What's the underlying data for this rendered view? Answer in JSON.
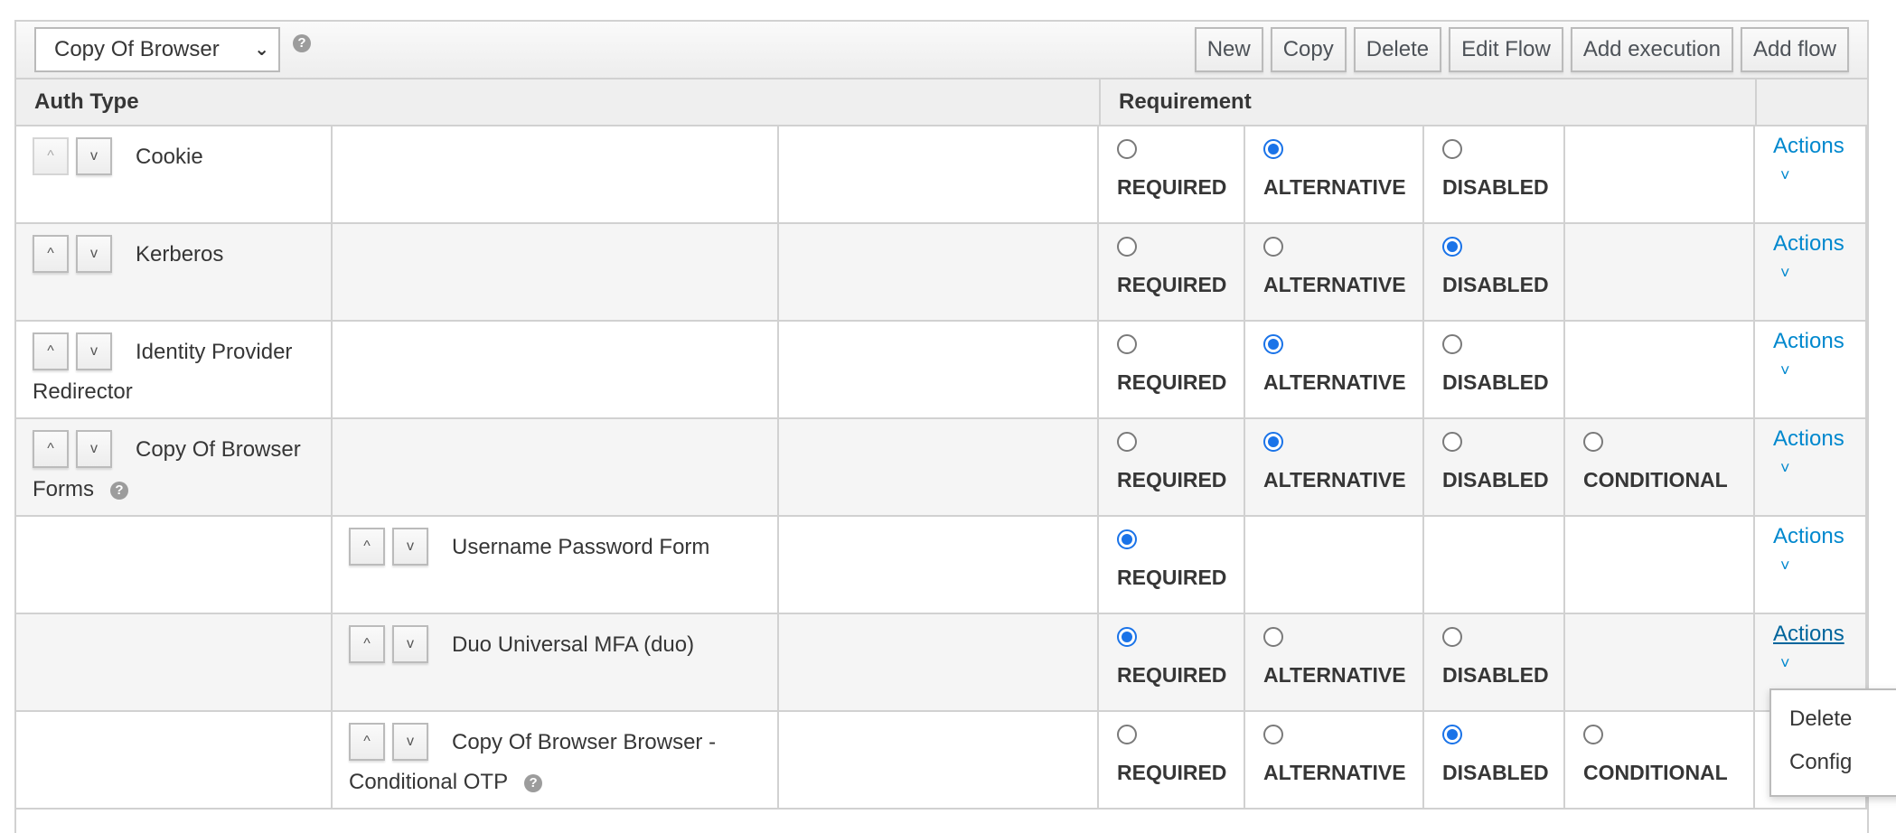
{
  "toolbar": {
    "flow_select_value": "Copy Of Browser",
    "help_icon": "question-circle-icon",
    "buttons": [
      "New",
      "Copy",
      "Delete",
      "Edit Flow",
      "Add execution",
      "Add flow"
    ]
  },
  "table": {
    "headers": {
      "auth_type": "Auth Type",
      "requirement": "Requirement"
    },
    "move_up_glyph": "^",
    "move_down_glyph": "v",
    "actions_label": "Actions",
    "actions_chevron": "⌄",
    "rows": [
      {
        "name": "Cookie",
        "level": 0,
        "help": false,
        "options": [
          "REQUIRED",
          "ALTERNATIVE",
          "DISABLED"
        ],
        "selected": "ALTERNATIVE"
      },
      {
        "name": "Kerberos",
        "level": 0,
        "help": false,
        "options": [
          "REQUIRED",
          "ALTERNATIVE",
          "DISABLED"
        ],
        "selected": "DISABLED"
      },
      {
        "name": "Identity Provider Redirector",
        "level": 0,
        "help": false,
        "options": [
          "REQUIRED",
          "ALTERNATIVE",
          "DISABLED"
        ],
        "selected": "ALTERNATIVE"
      },
      {
        "name": "Copy Of Browser Forms",
        "level": 0,
        "help": true,
        "options": [
          "REQUIRED",
          "ALTERNATIVE",
          "DISABLED",
          "CONDITIONAL"
        ],
        "selected": "ALTERNATIVE"
      },
      {
        "name": "Username Password Form",
        "level": 1,
        "help": false,
        "options": [
          "REQUIRED"
        ],
        "selected": "REQUIRED"
      },
      {
        "name": "Duo Universal MFA   (duo)",
        "level": 1,
        "help": false,
        "options": [
          "REQUIRED",
          "ALTERNATIVE",
          "DISABLED"
        ],
        "selected": "REQUIRED",
        "actions_open": true
      },
      {
        "name": "Copy Of Browser Browser - Conditional OTP",
        "level": 1,
        "help": true,
        "options": [
          "REQUIRED",
          "ALTERNATIVE",
          "DISABLED",
          "CONDITIONAL"
        ],
        "selected": "DISABLED"
      }
    ]
  },
  "actions_menu": {
    "items": [
      "Delete",
      "Config"
    ]
  },
  "colors": {
    "accent": "#1a73e8",
    "link": "#0088ce"
  }
}
